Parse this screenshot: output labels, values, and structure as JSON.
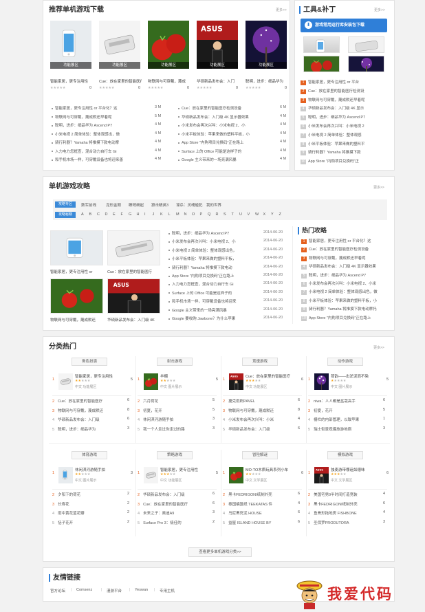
{
  "section1": {
    "title": "推荐单机游戏下载",
    "more": "更多>>",
    "thumbs": [
      {
        "overlay": "功能展区",
        "caption": "智能家居，更专注用性",
        "count": "0"
      },
      {
        "overlay": "功能展区",
        "caption": "Cue：放在家里的智能医疗",
        "count": "0"
      },
      {
        "overlay": "功能展区",
        "caption": "物联网与可穿戴，蔑成",
        "count": "0"
      },
      {
        "overlay": "功能展区",
        "caption": "华硕新品发布会：入门",
        "count": "0"
      },
      {
        "overlay": "功能展区",
        "caption": "聪明，进步：细品华为",
        "count": "0"
      }
    ],
    "left_list": [
      {
        "text": "智能家居，更专注用性 or 平台化？这",
        "size": "3 M"
      },
      {
        "text": "物联网与可穿戴，蔑成默还早着呢",
        "size": "5 M"
      },
      {
        "text": "聪明，进步：细品华为 Ascend P7",
        "size": "4 M"
      },
      {
        "text": "小米电视 2 简单体验：整体观感出，做",
        "size": "4 M"
      },
      {
        "text": "骑行利器？Yamaha 将推摸下款电动摩",
        "size": "4 M"
      },
      {
        "text": "入力电力您框查，混合动力自行车 Gi",
        "size": "4 M"
      },
      {
        "text": "和手机市场一样，可穿戴设备也将迎来善",
        "size": "4 M"
      }
    ],
    "mid_list": [
      {
        "text": "Cue：放在家里的智能医疗检测设备",
        "size": "6 M"
      },
      {
        "text": "华硕新品发布会：入门级 4K 显示器效果",
        "size": "4 M"
      },
      {
        "text": "小米发布会再次兴叫：小米电视 2、小",
        "size": "4 M"
      },
      {
        "text": "小米平板体验：苹果来做的塑料平板，小",
        "size": "4 M"
      },
      {
        "text": "App Store \"内购项目兑换码\"正在路上",
        "size": "4 M"
      },
      {
        "text": "Surface 上的 Office 可能是这样子的",
        "size": "4 M"
      },
      {
        "text": "Google 主义带来的一场亮满风暴",
        "size": "4 M"
      }
    ]
  },
  "tools": {
    "title": "工具&补丁",
    "more": "更多>>",
    "button": "游戏常用运行库安装包下载",
    "ranks": [
      "智能家居，更专注用性 or 平台",
      "Cue：放在家里的智能医疗检测设",
      "物联网与可穿戴，蔑成默还早着呢",
      "华硕新品发布会：入门级 4K 显示",
      "聪明，进步：细品华为 Ascend P7",
      "小米发布会再次兴叫：小米电视 2",
      "小米电视 2 简单体验：整体观感",
      "小米平板体验：苹果来做的塑料平",
      "骑行利器？Yamaha 将推摸下款",
      "App Store \"内购项目兑换码\"正"
    ]
  },
  "section2": {
    "title": "单机游戏攻略",
    "more": "更多>>",
    "filter1": {
      "tag": "攻略专区",
      "items": [
        "数军前线",
        "龙形金刚",
        "瞭哨细起",
        "狼击精英3",
        "谍杀：灵魂碰犯",
        "我的世界"
      ]
    },
    "filter2": {
      "tag": "攻略秘籍",
      "items": [
        "A",
        "B",
        "C",
        "D",
        "E",
        "F",
        "G",
        "H",
        "I",
        "J",
        "K",
        "L",
        "M",
        "N",
        "O",
        "P",
        "Q",
        "R",
        "S",
        "T",
        "U",
        "V",
        "W",
        "X",
        "Y",
        "Z"
      ]
    },
    "thumbs": [
      "智能家居，更专注用性 or",
      "Cue：放在家里的智能医疗",
      "物联网与可穿戴，蔑成默还",
      "华硕新品发布会：入门级 4K"
    ],
    "list": [
      {
        "text": "聪明，进步：细品华为 Ascend P7",
        "date": "2014-06-20"
      },
      {
        "text": "小米发布会再次兴叫：小米电视 2、小",
        "date": "2014-06-20"
      },
      {
        "text": "小米电视 2 简单体验：整体观感出色，",
        "date": "2014-06-20"
      },
      {
        "text": "小米平板体验：苹果来做的塑料平板，",
        "date": "2014-06-20"
      },
      {
        "text": "骑行利器？Yamaha 将推摸下款电动",
        "date": "2014-06-20"
      },
      {
        "text": "App Store \"内购项目兑换码\"正在路上",
        "date": "2014-06-20"
      },
      {
        "text": "入力电力您框查，混合动力自行车 Gi",
        "date": "2014-06-20"
      },
      {
        "text": "Surface 上的 Office 可能是这样子的",
        "date": "2014-06-20"
      },
      {
        "text": "和手机市场一样，可穿戴设备也将迎来",
        "date": "2014-06-20"
      },
      {
        "text": "Google 主义带来的一场亮满风暴",
        "date": "2014-06-20"
      },
      {
        "text": "Google 要收购 Jawbone？为什么苹果",
        "date": "2014-06-20"
      }
    ],
    "hot_title": "热门攻略",
    "hot": [
      "智能家居，更专注用性 or 平台化？这",
      "Cue：放在家里的智能医疗检测设备",
      "物联网与可穿戴，蔑成默还早着呢",
      "华硕新品发布会：入门级 4K 显示器效果",
      "聪明，进步：细品华为 Ascend P7",
      "小米发布会再次兴叫：小米电视 2、小米",
      "小米电视 2 简单体验：整体观感出色，做",
      "小米平板体验：苹果来做的塑料平板，小",
      "骑行利器？Yamaha 将推摸下款电动摩托",
      "App Store \"内购项目兑换码\"正在路上"
    ]
  },
  "section3": {
    "title": "分类热门",
    "more": "更多>>",
    "more_button": "查看更多单机游戏分类>>",
    "categories": [
      {
        "tag": "角色扮演",
        "top": {
          "title": "智能家居，更专注用性",
          "meta": "中文  功能展区",
          "value": "5"
        },
        "rows": [
          {
            "t": "Cue：放在家里的智能医疗",
            "v": "6"
          },
          {
            "t": "物联网与可穿戴，蔑成默还",
            "v": "8"
          },
          {
            "t": "华硕新品发布会：入门级",
            "v": "6"
          },
          {
            "t": "聪明，进步：细品华为",
            "v": "3"
          }
        ]
      },
      {
        "tag": "射击游戏",
        "top": {
          "title": "羊棚",
          "meta": "中文  图片展示",
          "value": "5"
        },
        "rows": [
          {
            "t": "六月荷花",
            "v": "5"
          },
          {
            "t": "初夏，花开",
            "v": "5"
          },
          {
            "t": "休闲淇河游随手拍",
            "v": "3"
          },
          {
            "t": "我一个人走过你走过的路",
            "v": "3"
          }
        ]
      },
      {
        "tag": "竞速游戏",
        "top": {
          "title": "Cue：放在家里的智能医疗",
          "meta": "中文  功能展区",
          "value": "6"
        },
        "rows": [
          {
            "t": "捷克雨刷PAVEL",
            "v": "6"
          },
          {
            "t": "物联网与可穿戴，蔑成默还",
            "v": "8"
          },
          {
            "t": "小米发布会再次兴叫：小米",
            "v": "4"
          },
          {
            "t": "华硕新品发布会：入门级",
            "v": "6"
          }
        ]
      },
      {
        "tag": "动作游戏",
        "top": {
          "title": "荷韵——出淤泥而不染",
          "meta": "中文  图片展示",
          "value": "5"
        },
        "rows": [
          {
            "t": "niwa：人人都是盆栽高手",
            "v": "6"
          },
          {
            "t": "初夏，花开",
            "v": "5"
          },
          {
            "t": "栅栏的内部管理，以致苹果",
            "v": "1"
          },
          {
            "t": "瑞士街景观爆旅游地宿",
            "v": "3"
          }
        ]
      },
      {
        "tag": "体育游戏",
        "top": {
          "title": "休闲淇河游随手拍",
          "meta": "中文  图片展示",
          "value": "3"
        },
        "rows": [
          {
            "t": "夕阳下的荷花",
            "v": "2"
          },
          {
            "t": "长寿花",
            "v": "2"
          },
          {
            "t": "雨中黄花蓝花瓣",
            "v": "2"
          },
          {
            "t": "恬子花开",
            "v": "2"
          }
        ]
      },
      {
        "tag": "策略游戏",
        "top": {
          "title": "智能家居，更专注用性",
          "meta": "中文  功能展区",
          "value": "5"
        },
        "rows": [
          {
            "t": "华硕新品发布会：入门级",
            "v": "6"
          },
          {
            "t": "Cue：放在家里的智能医疗",
            "v": "6"
          },
          {
            "t": "未来之子：奥迪A9",
            "v": "3"
          },
          {
            "t": "Surface Pro 3：极佳的",
            "v": "2"
          }
        ]
      },
      {
        "tag": "冒险解谜",
        "top": {
          "title": "MO-TO木质玩具系列小车",
          "meta": "中文  文学展区",
          "value": "6"
        },
        "rows": [
          {
            "t": "黑卡FEDRIGONI纸制外壳",
            "v": "6"
          },
          {
            "t": "泰国编篮纸 TEEKATAS 件",
            "v": "4"
          },
          {
            "t": "乌尼黑死泥 HOUSE",
            "v": "6"
          },
          {
            "t": "益屋 ISLAND HOUSE BY",
            "v": "6"
          }
        ]
      },
      {
        "tag": "模拟游戏",
        "top": {
          "title": "独麦游带哪追如德味",
          "meta": "中文  文学展区",
          "value": "6"
        },
        "rows": [
          {
            "t": "美国宅男9半时间打造竞装",
            "v": "4"
          },
          {
            "t": "黑卡FEDRIGONI纸制外壳",
            "v": "6"
          },
          {
            "t": "鱼骨形拖地房 FISHBONE",
            "v": "4"
          },
          {
            "t": "圣保罗PRODUTORA",
            "v": "3"
          }
        ]
      }
    ]
  },
  "links": {
    "title": "友情链接",
    "items": [
      "官方论坛",
      "Comsenz",
      "漫游平台",
      "Yeswan",
      "专用主机"
    ]
  },
  "watermark": "我爱代码",
  "colors": {
    "accent": "#2f7fd8",
    "hot": "#e5601e"
  }
}
